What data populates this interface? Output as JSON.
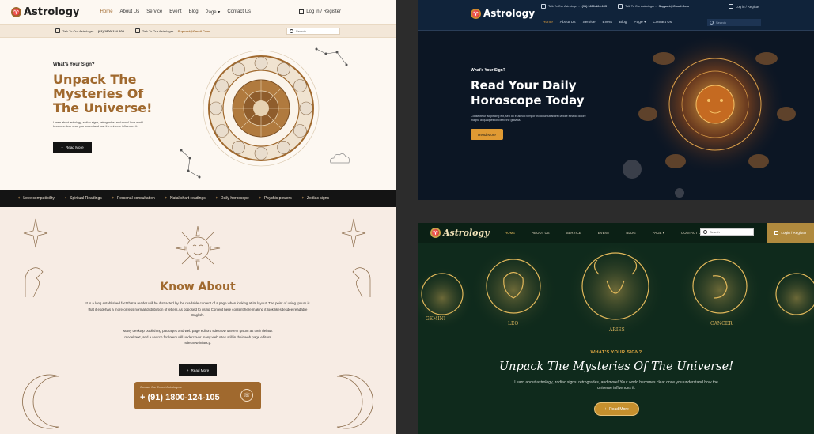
{
  "light": {
    "brand": "Astrology",
    "nav": [
      "Home",
      "About Us",
      "Service",
      "Event",
      "Blog",
      "Page ▾",
      "Contact Us"
    ],
    "login": "Log in / Register",
    "topbar": {
      "talk_label": "Talk To Our Astrologer -",
      "talk_value": "(91) 1800-124-105",
      "mail_label": "Talk To Our Astrologer -",
      "mail_value": "Support@Gmail.Com",
      "search_placeholder": "Search"
    },
    "hero": {
      "eyebrow": "What's Your Sign?",
      "title": "Unpack The Mysteries Of The Universe!",
      "text": "Lorem about astrology, zodiac signs, retrogrades, and more! Your world becomes clear once you understand how the universe influences it.",
      "button": "Read More"
    },
    "ticker": [
      "Love compatibility",
      "Spiritual Readings",
      "Personal consultation",
      "Natal chart readings",
      "Daily horoscope",
      "Psychic powers",
      "Zodiac signs"
    ],
    "about": {
      "title": "Know About",
      "p1": "It is a long established fact that a reader will be distracted by the readable content of a page when looking at its layout. The point of using Ipsum is that it esdehas a more-or less normal distribution of letters.As opposed to using Content here content here making it look likesdesdee readable English.",
      "p2": "Many desktop publishing packages and web page editors sdesnow use em Ipsum as their default model text, and a search for lorem will undercover many web sites still in their web page editors sdesnow infancy.",
      "button": "Read More",
      "contact_label": "Contact Our Expert Astrologers",
      "contact_number": "+ (91) 1800-124-105"
    }
  },
  "navy": {
    "brand": "Astrology",
    "topbar": {
      "talk_label": "Talk To Our Astrologer -",
      "talk_value": "(91) 1800-124-105",
      "mail_label": "Talk To Our Astrologer -",
      "mail_value": "Support@Gmail.Com"
    },
    "login": "Log in / Register",
    "nav": [
      "Home",
      "About Us",
      "Service",
      "Event",
      "Blog",
      "Page ▾",
      "Contact Us"
    ],
    "search_placeholder": "Search",
    "hero": {
      "eyebrow": "What's Your Sign?",
      "title": "Read Your Daily Horoscope Today",
      "text": "Consectetur adipiscing elit, sed do eiusmod tempor incididuntutlaboret labore etnado dolore magna aliquaquestioncised the gravida.",
      "button": "Read More"
    }
  },
  "green": {
    "brand": "Astrology",
    "nav": [
      "HOME",
      "ABOUT US",
      "SERVICE",
      "EVENT",
      "BLOG",
      "PAGE ▾",
      "CONTACT US"
    ],
    "search_placeholder": "Search",
    "login": "Login / Register",
    "signs": [
      "GEMINI",
      "LEO",
      "ARIES",
      "CANCER"
    ],
    "eyebrow": "WHAT'S YOUR SIGN?",
    "title": "Unpack The Mysteries Of The Universe!",
    "text": "Learn about astrology, zodiac signs, retrogrades, and more! Your world becomes clear once you understand how the universe influences it.",
    "button": "Read More"
  },
  "colors": {
    "light_accent": "#a0692e",
    "navy_accent": "#e09a33",
    "green_accent": "#c6902e"
  }
}
